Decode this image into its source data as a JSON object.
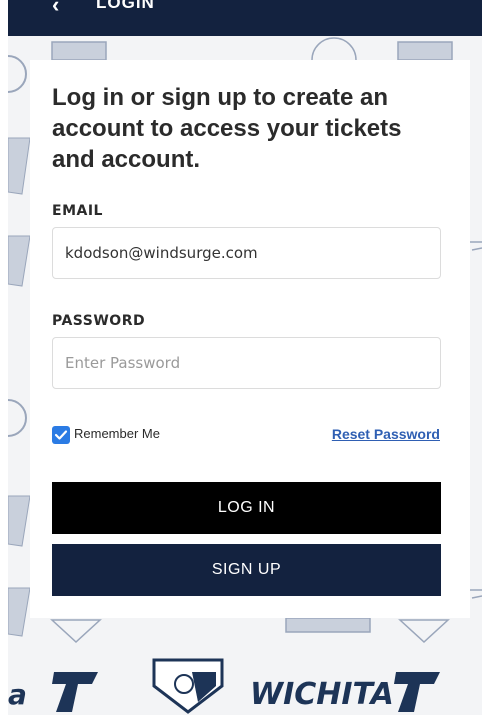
{
  "nav": {
    "title": "LOGIN"
  },
  "pattern": {
    "logo_words": [
      "WICHITA"
    ]
  },
  "login": {
    "headline": "Log in or sign up to create an account to access your tickets and account.",
    "email_label": "EMAIL",
    "email_value": "kdodson@windsurge.com",
    "password_label": "PASSWORD",
    "password_placeholder": "Enter Password",
    "remember_label": "Remember Me",
    "remember_checked": true,
    "reset_label": "Reset Password",
    "login_button": "LOG IN",
    "signup_button": "SIGN UP"
  },
  "colors": {
    "navy": "#13223f",
    "black": "#000000",
    "link": "#2f5fb3",
    "checkbox": "#2b7be4"
  }
}
